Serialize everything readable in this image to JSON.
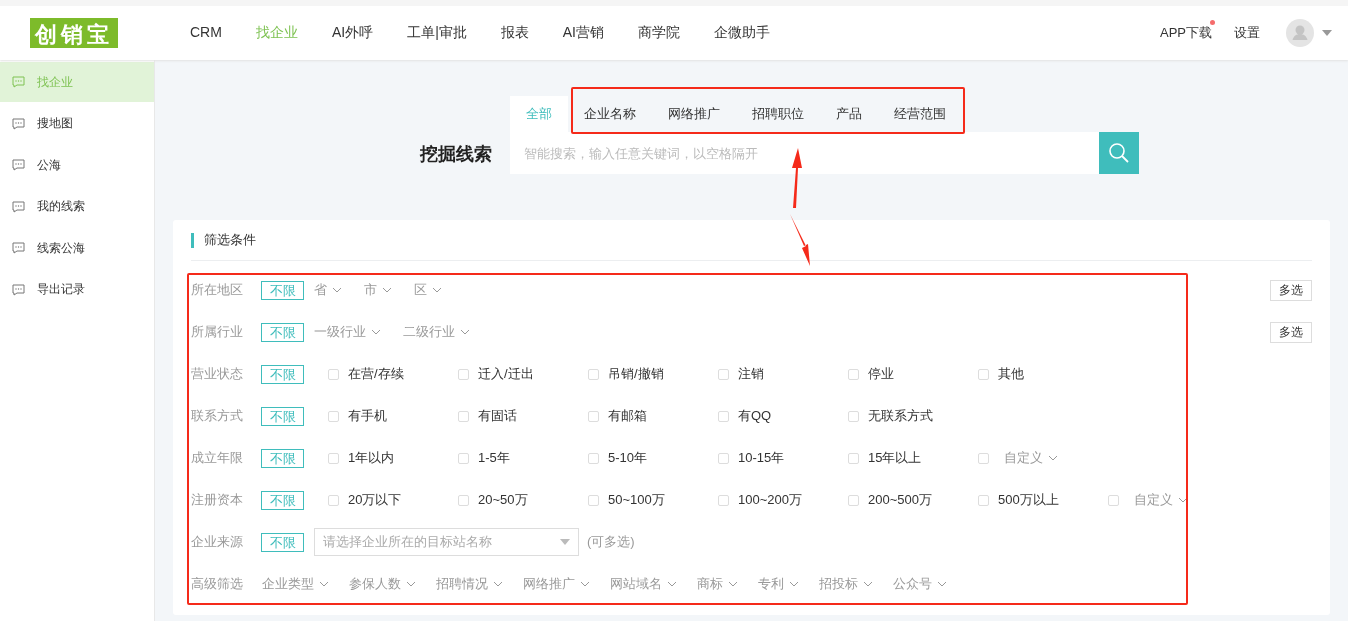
{
  "header": {
    "logo": "创销宝",
    "nav": [
      {
        "label": "CRM",
        "selected": false
      },
      {
        "label": "找企业",
        "selected": true
      },
      {
        "label": "AI外呼",
        "selected": false
      },
      {
        "label": "工单|审批",
        "selected": false
      },
      {
        "label": "报表",
        "selected": false
      },
      {
        "label": "AI营销",
        "selected": false
      },
      {
        "label": "商学院",
        "selected": false
      },
      {
        "label": "企微助手",
        "selected": false
      }
    ],
    "app_download": {
      "label": "APP下载",
      "notify": true
    },
    "settings": "设置"
  },
  "sidebar": {
    "items": [
      {
        "label": "找企业",
        "selected": true
      },
      {
        "label": "搜地图",
        "selected": false
      },
      {
        "label": "公海",
        "selected": false
      },
      {
        "label": "我的线索",
        "selected": false
      },
      {
        "label": "线索公海",
        "selected": false
      },
      {
        "label": "导出记录",
        "selected": false
      }
    ]
  },
  "search": {
    "title": "挖掘线索",
    "tabs": [
      {
        "label": "全部",
        "selected": true
      },
      {
        "label": "企业名称",
        "selected": false
      },
      {
        "label": "网络推广",
        "selected": false
      },
      {
        "label": "招聘职位",
        "selected": false
      },
      {
        "label": "产品",
        "selected": false
      },
      {
        "label": "经营范围",
        "selected": false
      }
    ],
    "placeholder": "智能搜索，输入任意关键词，以空格隔开"
  },
  "filters": {
    "title": "筛选条件",
    "rows": [
      {
        "kind": "dropdowns",
        "label": "所在地区",
        "any": "不限",
        "any_selected": true,
        "multi": "多选",
        "options": [
          {
            "label": "省"
          },
          {
            "label": "市"
          },
          {
            "label": "区"
          }
        ]
      },
      {
        "kind": "dropdowns",
        "label": "所属行业",
        "any": "不限",
        "any_selected": true,
        "multi": "多选",
        "options": [
          {
            "label": "一级行业"
          },
          {
            "label": "二级行业"
          }
        ]
      },
      {
        "kind": "checkboxes",
        "label": "营业状态",
        "any": "不限",
        "any_selected": true,
        "options": [
          {
            "kind": "checkbox",
            "label": "在营/存续",
            "checked": false
          },
          {
            "kind": "checkbox",
            "label": "迁入/迁出",
            "checked": false
          },
          {
            "kind": "checkbox",
            "label": "吊销/撤销",
            "checked": false
          },
          {
            "kind": "checkbox",
            "label": "注销",
            "checked": false
          },
          {
            "kind": "checkbox",
            "label": "停业",
            "checked": false
          },
          {
            "kind": "checkbox",
            "label": "其他",
            "checked": false
          }
        ]
      },
      {
        "kind": "checkboxes",
        "label": "联系方式",
        "any": "不限",
        "any_selected": true,
        "options": [
          {
            "kind": "checkbox",
            "label": "有手机",
            "checked": false
          },
          {
            "kind": "checkbox",
            "label": "有固话",
            "checked": false
          },
          {
            "kind": "checkbox",
            "label": "有邮箱",
            "checked": false
          },
          {
            "kind": "checkbox",
            "label": "有QQ",
            "checked": false
          },
          {
            "kind": "checkbox",
            "label": "无联系方式",
            "checked": false
          }
        ]
      },
      {
        "kind": "checkboxes",
        "label": "成立年限",
        "any": "不限",
        "any_selected": true,
        "options": [
          {
            "kind": "checkbox",
            "label": "1年以内",
            "checked": false
          },
          {
            "kind": "checkbox",
            "label": "1-5年",
            "checked": false
          },
          {
            "kind": "checkbox",
            "label": "5-10年",
            "checked": false
          },
          {
            "kind": "checkbox",
            "label": "10-15年",
            "checked": false
          },
          {
            "kind": "checkbox",
            "label": "15年以上",
            "checked": false
          },
          {
            "kind": "custom",
            "label": "自定义",
            "checked": false
          }
        ]
      },
      {
        "kind": "checkboxes",
        "label": "注册资本",
        "any": "不限",
        "any_selected": true,
        "options": [
          {
            "kind": "checkbox",
            "label": "20万以下",
            "checked": false
          },
          {
            "kind": "checkbox",
            "label": "20~50万",
            "checked": false
          },
          {
            "kind": "checkbox",
            "label": "50~100万",
            "checked": false
          },
          {
            "kind": "checkbox",
            "label": "100~200万",
            "checked": false
          },
          {
            "kind": "checkbox",
            "label": "200~500万",
            "checked": false
          },
          {
            "kind": "checkbox",
            "label": "500万以上",
            "checked": false
          },
          {
            "kind": "custom",
            "label": "自定义",
            "checked": false
          }
        ]
      },
      {
        "kind": "select",
        "label": "企业来源",
        "any": "不限",
        "any_selected": true,
        "placeholder": "请选择企业所在的目标站名称",
        "hint": "(可多选)"
      },
      {
        "kind": "advanced",
        "label": "高级筛选",
        "options": [
          {
            "label": "企业类型"
          },
          {
            "label": "参保人数"
          },
          {
            "label": "招聘情况"
          },
          {
            "label": "网络推广"
          },
          {
            "label": "网站域名"
          },
          {
            "label": "商标"
          },
          {
            "label": "专利"
          },
          {
            "label": "招投标"
          },
          {
            "label": "公众号"
          }
        ]
      }
    ]
  }
}
